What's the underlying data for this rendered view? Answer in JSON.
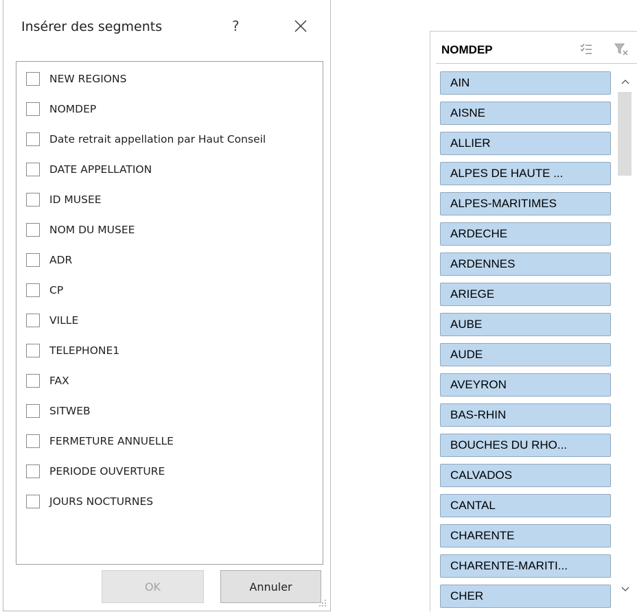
{
  "dialog": {
    "title": "Insérer des segments",
    "help": "?",
    "fields": [
      "NEW REGIONS",
      "NOMDEP",
      "Date retrait appellation par Haut Conseil",
      "DATE APPELLATION",
      "ID MUSEE",
      "NOM DU MUSEE",
      "ADR",
      "CP",
      "VILLE",
      "TELEPHONE1",
      "FAX",
      "SITWEB",
      "FERMETURE ANNUELLE",
      "PERIODE OUVERTURE",
      "JOURS NOCTURNES"
    ],
    "ok_label": "OK",
    "cancel_label": "Annuler"
  },
  "slicer": {
    "header": "NOMDEP",
    "items": [
      "AIN",
      "AISNE",
      "ALLIER",
      "ALPES DE HAUTE ...",
      "ALPES-MARITIMES",
      "ARDECHE",
      "ARDENNES",
      "ARIEGE",
      "AUBE",
      "AUDE",
      "AVEYRON",
      "BAS-RHIN",
      "BOUCHES DU RHO...",
      "CALVADOS",
      "CANTAL",
      "CHARENTE",
      "CHARENTE-MARITI...",
      "CHER"
    ]
  },
  "colors": {
    "slicer_item_bg": "#bdd7ee",
    "slicer_item_border": "#90a8bf"
  },
  "icons": {
    "close": "close-icon",
    "multiselect": "multi-select-icon",
    "clear_filter": "clear-filter-icon",
    "scroll_up": "chevron-up-icon",
    "scroll_down": "chevron-down-icon"
  }
}
